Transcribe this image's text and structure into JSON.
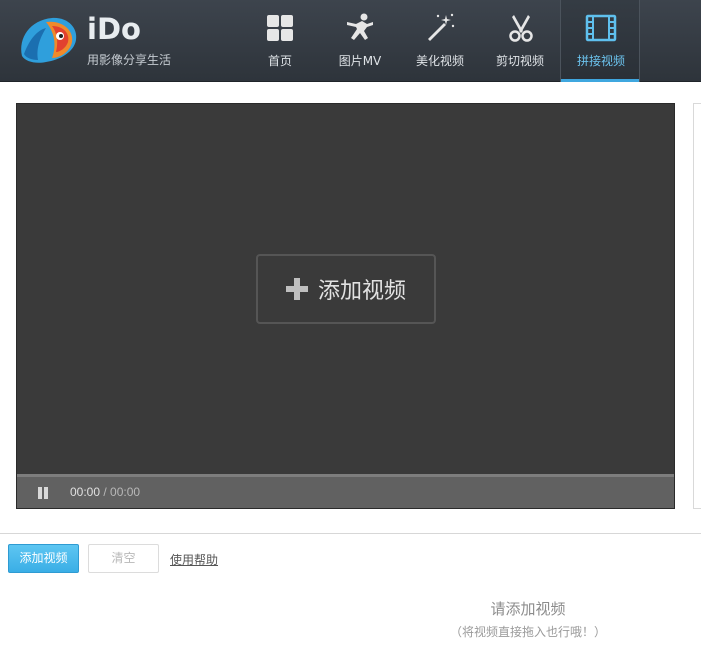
{
  "header": {
    "brand": "iDo",
    "slogan": "用影像分享生活",
    "colors": {
      "background": "#353b42",
      "active_accent": "#3fa7df"
    },
    "nav": [
      {
        "label": "首页",
        "icon": "grid-icon",
        "active": false
      },
      {
        "label": "图片MV",
        "icon": "dancer-icon",
        "active": false
      },
      {
        "label": "美化视频",
        "icon": "magic-wand-icon",
        "active": false
      },
      {
        "label": "剪切视频",
        "icon": "scissors-icon",
        "active": false
      },
      {
        "label": "拼接视频",
        "icon": "film-strip-icon",
        "active": true
      }
    ]
  },
  "player": {
    "add_video_label": "添加视频",
    "current_time": "00:00",
    "separator": " / ",
    "total_time": "00:00"
  },
  "toolbar": {
    "add_video_button": "添加视频",
    "clear_button": "清空",
    "help_link": "使用帮助"
  },
  "empty_state": {
    "title": "请添加视频",
    "hint": "（将视频直接拖入也行哦！）"
  }
}
